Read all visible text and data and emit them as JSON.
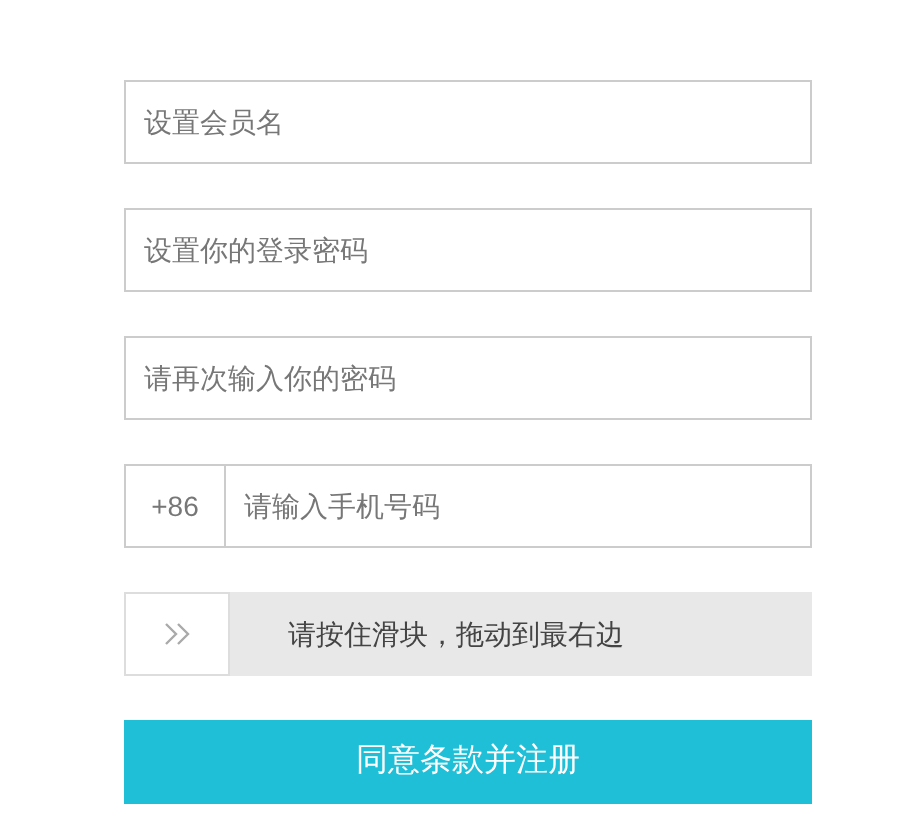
{
  "fields": [
    {
      "placeholder": "设置会员名"
    },
    {
      "placeholder": "设置你的登录密码"
    },
    {
      "placeholder": "请再次输入你的密码"
    }
  ],
  "phone": {
    "prefix": "+86",
    "placeholder": "请输入手机号码"
  },
  "slider": {
    "label": "请按住滑块，拖动到最右边",
    "level": 0
  },
  "submit": {
    "label": "同意条款并注册"
  }
}
